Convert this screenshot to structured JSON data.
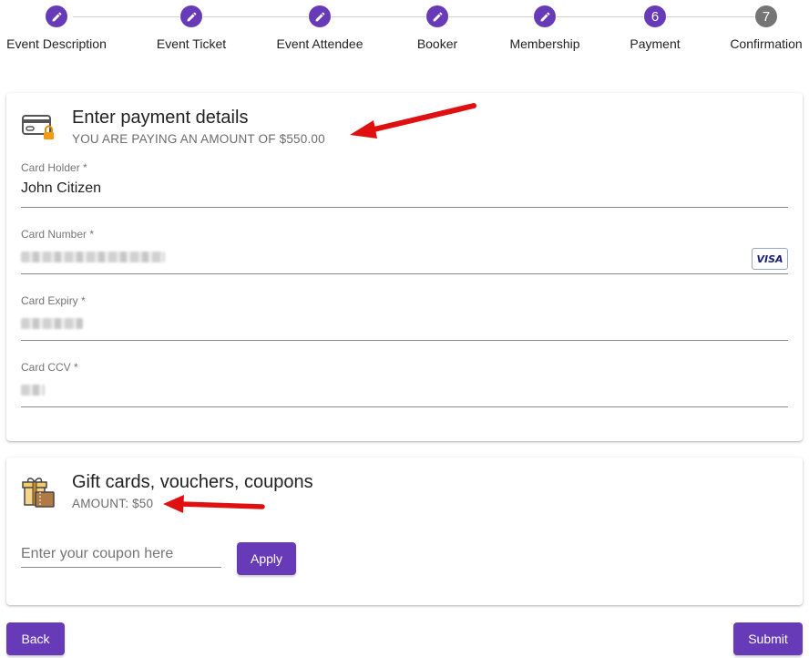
{
  "stepper": {
    "steps": [
      {
        "label": "Event Description",
        "state": "done",
        "icon": "pencil-icon"
      },
      {
        "label": "Event Ticket",
        "state": "done",
        "icon": "pencil-icon"
      },
      {
        "label": "Event Attendee",
        "state": "done",
        "icon": "pencil-icon"
      },
      {
        "label": "Booker",
        "state": "done",
        "icon": "pencil-icon"
      },
      {
        "label": "Membership",
        "state": "done",
        "icon": "pencil-icon"
      },
      {
        "label": "Payment",
        "state": "active",
        "number": "6"
      },
      {
        "label": "Confirmation",
        "state": "pending",
        "number": "7"
      }
    ]
  },
  "payment": {
    "icon": "credit-card-lock-icon",
    "title": "Enter payment details",
    "subtitle": "YOU ARE PAYING AN AMOUNT OF $550.00",
    "fields": {
      "card_holder": {
        "label": "Card Holder *",
        "value": "John Citizen"
      },
      "card_number": {
        "label": "Card Number *",
        "brand": "VISA"
      },
      "card_expiry": {
        "label": "Card Expiry *"
      },
      "card_ccv": {
        "label": "Card CCV *"
      }
    }
  },
  "gift": {
    "icon": "gift-voucher-icon",
    "title": "Gift cards, vouchers, coupons",
    "subtitle": "AMOUNT: $50",
    "coupon_placeholder": "Enter your coupon here",
    "apply_label": "Apply"
  },
  "footer": {
    "back_label": "Back",
    "submit_label": "Submit"
  },
  "colors": {
    "accent": "#673ab7",
    "pending_step": "#757575",
    "annotation_arrow": "#e01010"
  }
}
